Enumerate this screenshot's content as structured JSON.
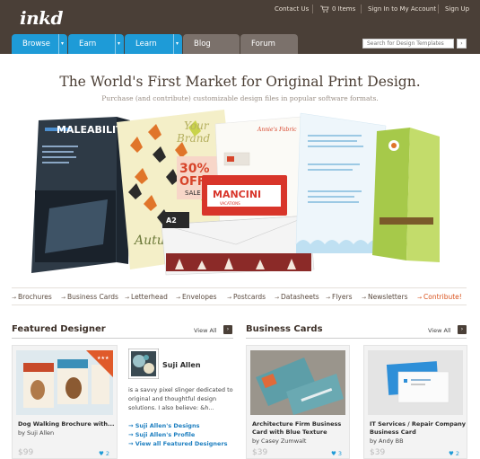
{
  "header": {
    "logo": "inkd",
    "links": {
      "contact": "Contact Us",
      "cart": "0 Items",
      "signin": "Sign In to My Account",
      "signup": "Sign Up"
    }
  },
  "nav": {
    "tabs": [
      {
        "label": "Browse"
      },
      {
        "label": "Earn"
      },
      {
        "label": "Learn"
      },
      {
        "label": "Blog"
      },
      {
        "label": "Forum"
      }
    ],
    "dropdown_glyph": "▾"
  },
  "search": {
    "placeholder": "Search for Design Templates",
    "button": "›"
  },
  "hero": {
    "title": "The World's First Market for Original Print Design.",
    "subtitle": "Purchase (and contribute) customizable design files in popular software formats.",
    "samples": {
      "brochure": "MALEABILITY",
      "brand_line1": "Your",
      "brand_line2": "Brand",
      "sale_pct": "30%",
      "sale_off": "OFF",
      "sale_word": "SALE",
      "mancini": "MANCINI",
      "vacations": "VACATIONS",
      "fabric": "Annie's Fabric",
      "a2": "A2",
      "autumn": "Autu..."
    }
  },
  "categories": [
    {
      "label": "Brochures",
      "highlight": false
    },
    {
      "label": "Business Cards",
      "highlight": false
    },
    {
      "label": "Letterhead",
      "highlight": false
    },
    {
      "label": "Envelopes",
      "highlight": false
    },
    {
      "label": "Postcards",
      "highlight": false
    },
    {
      "label": "Datasheets",
      "highlight": false
    },
    {
      "label": "Flyers",
      "highlight": false
    },
    {
      "label": "Newsletters",
      "highlight": false
    },
    {
      "label": "Contribute!",
      "highlight": true
    }
  ],
  "featured": {
    "heading": "Featured Designer",
    "view_all": "View All",
    "arrow": "›",
    "card": {
      "title": "Dog Walking Brochure with...",
      "by": "by Suji Allen",
      "price": "$99",
      "likes": "2"
    },
    "designer": {
      "name": "Suji Allen",
      "bio": "is a savvy pixel slinger dedicated to original and thoughtful design solutions. I also believe: &h...",
      "links": [
        "Suji Allen's Designs",
        "Suji Allen's Profile",
        "View all Featured Designers"
      ]
    }
  },
  "business": {
    "heading": "Business Cards",
    "view_all": "View All",
    "arrow": "›",
    "cards": [
      {
        "title_l1": "Architecture Firm Business",
        "title_l2": "Card with Blue Texture",
        "by": "by Casey Zumwalt",
        "price": "$39",
        "likes": "3"
      },
      {
        "title_l1": "IT Services / Repair Company",
        "title_l2": "Business Card",
        "by": "by Andy BB",
        "price": "$39",
        "likes": "2"
      }
    ]
  },
  "colors": {
    "header_bg": "#4a3f37",
    "nav_active": "#1e9bd7",
    "nav_inactive": "#7b716b",
    "accent": "#d9531e",
    "link": "#1e7fc0"
  }
}
